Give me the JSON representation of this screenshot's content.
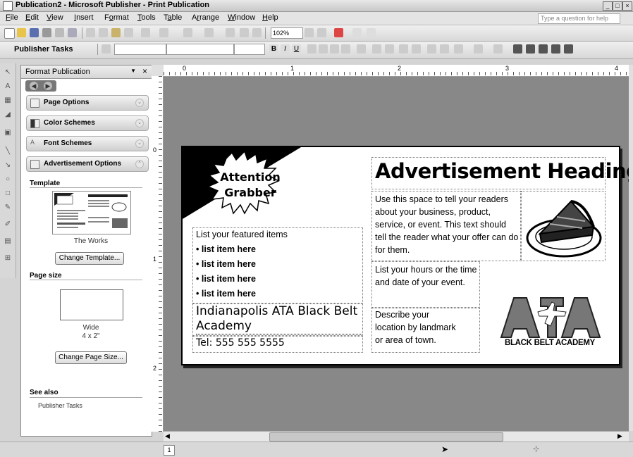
{
  "window": {
    "title": "Publication2 - Microsoft Publisher - Print Publication",
    "minimize": "_",
    "maximize": "□",
    "close": "×"
  },
  "menubar": {
    "items": [
      {
        "label": "File",
        "key": "F"
      },
      {
        "label": "Edit",
        "key": "E"
      },
      {
        "label": "View",
        "key": "V"
      },
      {
        "label": "Insert",
        "key": "I"
      },
      {
        "label": "Format",
        "key": "o"
      },
      {
        "label": "Tools",
        "key": "T"
      },
      {
        "label": "Table",
        "key": "a"
      },
      {
        "label": "Arrange",
        "key": "r"
      },
      {
        "label": "Window",
        "key": "W"
      },
      {
        "label": "Help",
        "key": "H"
      }
    ],
    "ask_placeholder": "Type a question for help"
  },
  "toolbar": {
    "zoom": "102%",
    "publisher_tasks": "Publisher Tasks"
  },
  "taskpane": {
    "title": "Format Publication",
    "sections": {
      "page_options": "Page Options",
      "color_schemes": "Color Schemes",
      "font_schemes": "Font Schemes",
      "ad_options": "Advertisement Options"
    },
    "template_label": "Template",
    "template_name": "The Works",
    "change_template": "Change Template...",
    "page_size_label": "Page size",
    "page_size_name": "Wide",
    "page_size_dims": "4 x 2\"",
    "change_page_size": "Change Page Size...",
    "see_also": "See also",
    "see_also_link": "Publisher Tasks"
  },
  "ruler": {
    "h_marks": [
      "0",
      "1",
      "2",
      "3",
      "4"
    ],
    "v_marks": [
      "0",
      "1",
      "2"
    ]
  },
  "publication": {
    "attention": "Attention\nGrabber",
    "heading": "Advertisement Heading",
    "body": "Use this space to tell your readers about your business, product, service, or event. This text should tell the reader what your offer can do for them.",
    "list_title": "List your featured items",
    "list_items": [
      "• list item here",
      "• list item here",
      "• list item here",
      "• list item here"
    ],
    "org_name": "Indianapolis ATA Black Belt Academy",
    "phone": "Tel: 555 555 5555",
    "hours": "List your hours or the time and date of your event.",
    "location": "Describe your location by landmark or area of town.",
    "logo_letters": "ATA",
    "logo_caption": "BLACK BELT ACADEMY"
  },
  "statusbar": {
    "page_number": "1"
  },
  "colors": {
    "page_border": "#000000",
    "workspace": "#888888",
    "logo_gray": "#777777",
    "logo_dark": "#222222"
  }
}
